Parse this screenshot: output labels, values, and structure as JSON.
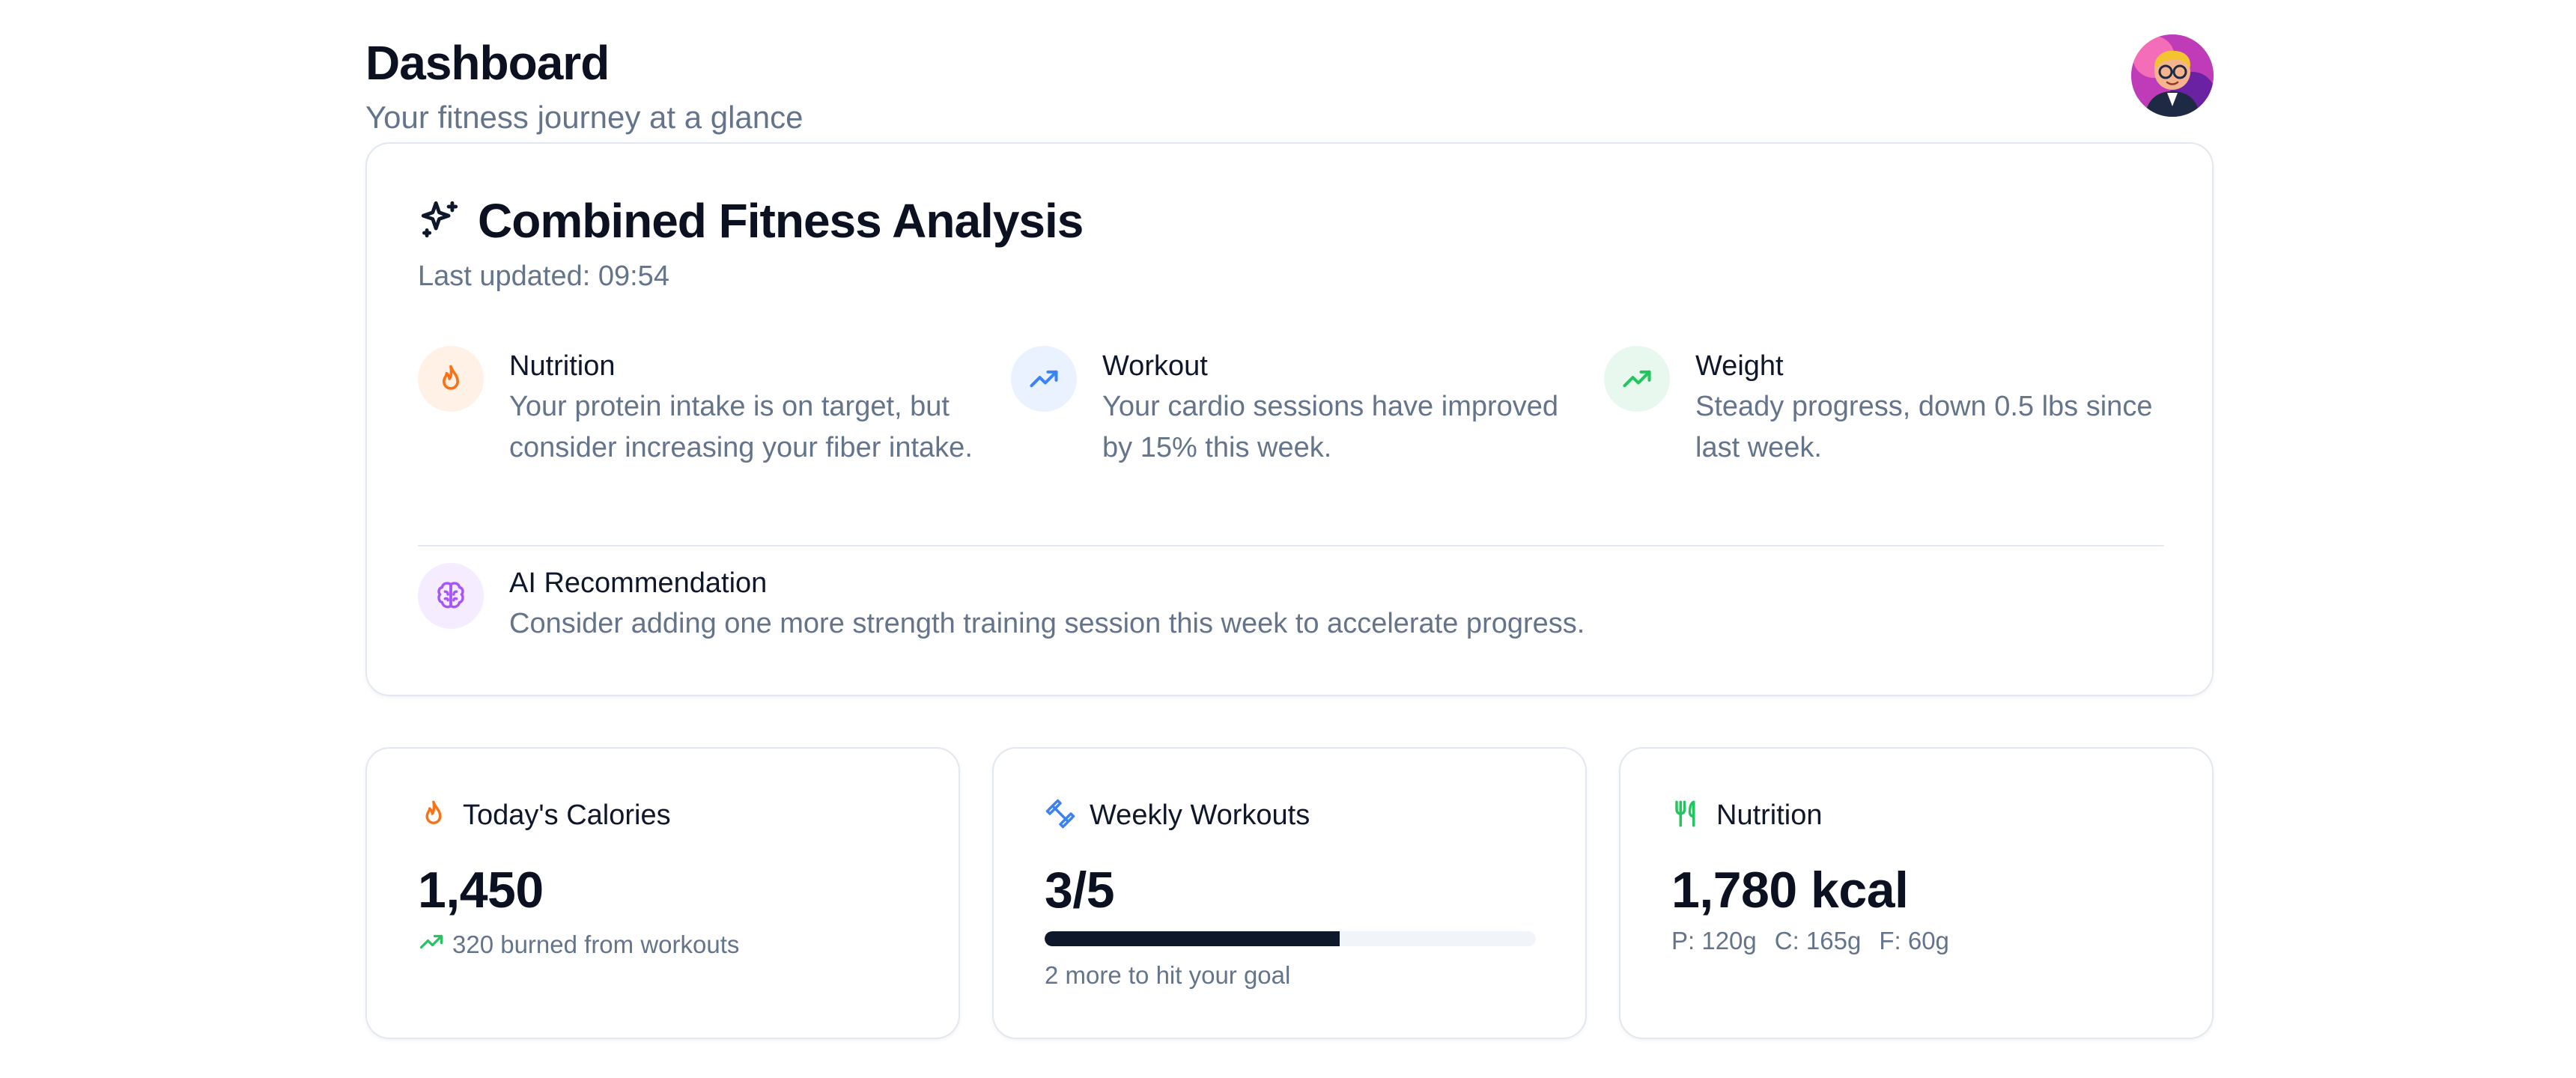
{
  "header": {
    "title": "Dashboard",
    "subtitle": "Your fitness journey at a glance",
    "avatar_icon": "user-avatar"
  },
  "analysis": {
    "icon": "sparkles-icon",
    "title": "Combined Fitness Analysis",
    "last_updated": "Last updated: 09:54",
    "insights": [
      {
        "icon": "flame-icon",
        "color": "#f97316",
        "bg": "#fff1e6",
        "title": "Nutrition",
        "body": "Your protein intake is on target, but consider increasing your fiber intake."
      },
      {
        "icon": "trending-up-icon",
        "color": "#3b82f6",
        "bg": "#eaf2ff",
        "title": "Workout",
        "body": "Your cardio sessions have improved by 15% this week."
      },
      {
        "icon": "trending-up-icon",
        "color": "#22c55e",
        "bg": "#e8f8ee",
        "title": "Weight",
        "body": "Steady progress, down 0.5 lbs since last week."
      }
    ],
    "recommendation": {
      "icon": "brain-icon",
      "color": "#a855f7",
      "title": "AI Recommendation",
      "body": "Consider adding one more strength training session this week to accelerate progress."
    }
  },
  "stats": {
    "calories": {
      "icon": "flame-icon",
      "label": "Today's Calories",
      "value": "1,450",
      "sub_icon": "trending-up-icon",
      "sub": "320 burned from workouts"
    },
    "workouts": {
      "icon": "dumbbell-icon",
      "label": "Weekly Workouts",
      "value": "3/5",
      "progress": 0.6,
      "sub": "2 more to hit your goal"
    },
    "nutrition": {
      "icon": "utensils-icon",
      "label": "Nutrition",
      "value": "1,780 kcal",
      "macros": [
        "P: 120g",
        "C: 165g",
        "F: 60g"
      ]
    }
  },
  "colors": {
    "orange": "#f97316",
    "blue": "#3b82f6",
    "green": "#22c55e",
    "purple": "#a855f7",
    "dark": "#0f172a"
  }
}
